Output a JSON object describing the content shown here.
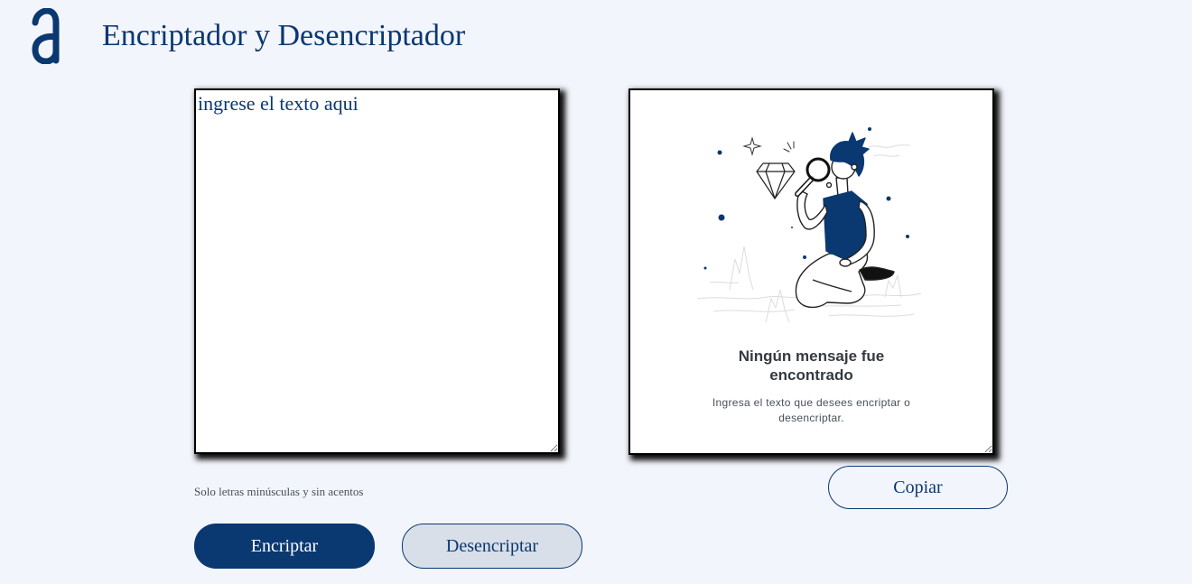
{
  "app": {
    "title": "Encriptador y Desencriptador",
    "logo_icon": "logo-icon"
  },
  "input": {
    "placeholder": "ingrese el texto aqui",
    "value": "",
    "hint": "Solo letras minúsculas y sin acentos"
  },
  "output": {
    "illustration": "person-with-magnifier-illustration",
    "empty_title": "Ningún mensaje fue encontrado",
    "empty_message": "Ingresa el texto que desees encriptar o desencriptar."
  },
  "actions": {
    "encrypt_label": "Encriptar",
    "decrypt_label": "Desencriptar",
    "copy_label": "Copiar"
  },
  "colors": {
    "primary": "#0A3871",
    "background": "#F3F5FC",
    "secondary_button": "#D8DFE8",
    "panel": "#FFFFFF",
    "heading": "#343A40",
    "muted": "#495057"
  }
}
